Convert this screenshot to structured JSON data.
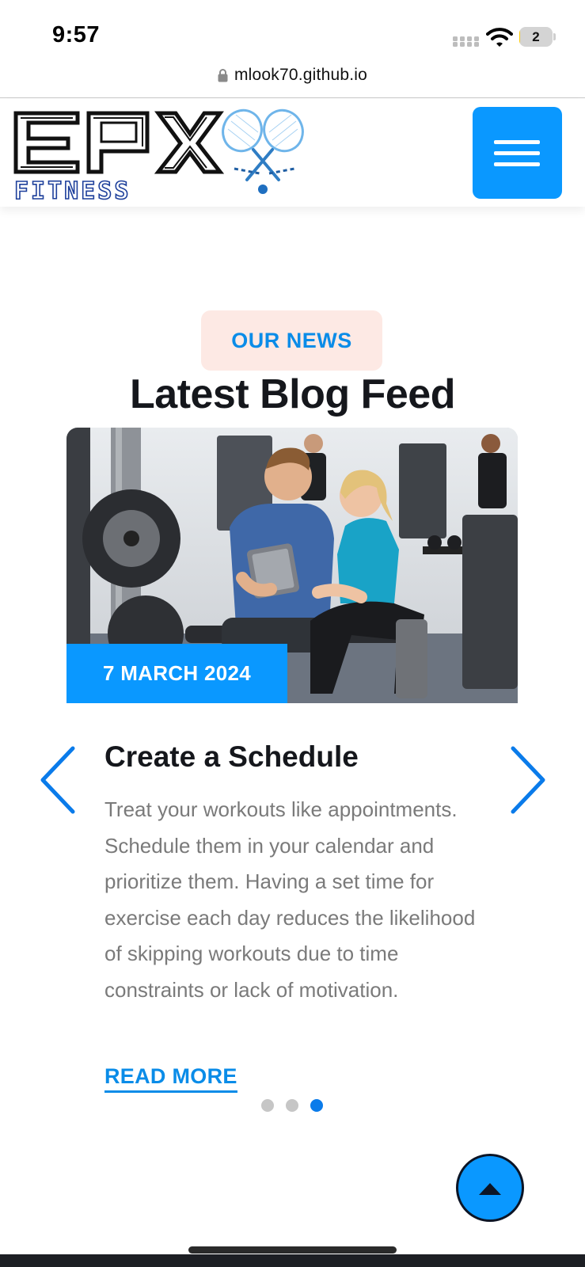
{
  "status_bar": {
    "time": "9:57",
    "battery_level": "2",
    "battery_color": "#ffcc00",
    "icons": [
      "cellular-signal-icon",
      "wifi-icon",
      "battery-icon"
    ]
  },
  "browser": {
    "url": "mlook70.github.io",
    "icons": [
      "lock-icon"
    ]
  },
  "header": {
    "logo_text": "EPX",
    "logo_subtext": "FITNESS",
    "menu_icon": "hamburger-menu-icon",
    "accent_color": "#0a98ff"
  },
  "section": {
    "badge": "OUR NEWS",
    "title": "Latest Blog Feed"
  },
  "post": {
    "date": "7 MARCH 2024",
    "title": "Create a Schedule",
    "body": "Treat your workouts like appointments. Schedule them in your calendar and prioritize them. Having a set time for exercise each day reduces the likelihood of skipping workouts due to time constraints or lack of motivation.",
    "read_more": "READ MORE",
    "image_alt": "man and woman looking at a tablet in a gym"
  },
  "carousel": {
    "prev_icon": "chevron-left-icon",
    "next_icon": "chevron-right-icon",
    "slide_count": 3,
    "active_slide": 3
  },
  "scroll_top": {
    "icon": "arrow-up-icon"
  }
}
